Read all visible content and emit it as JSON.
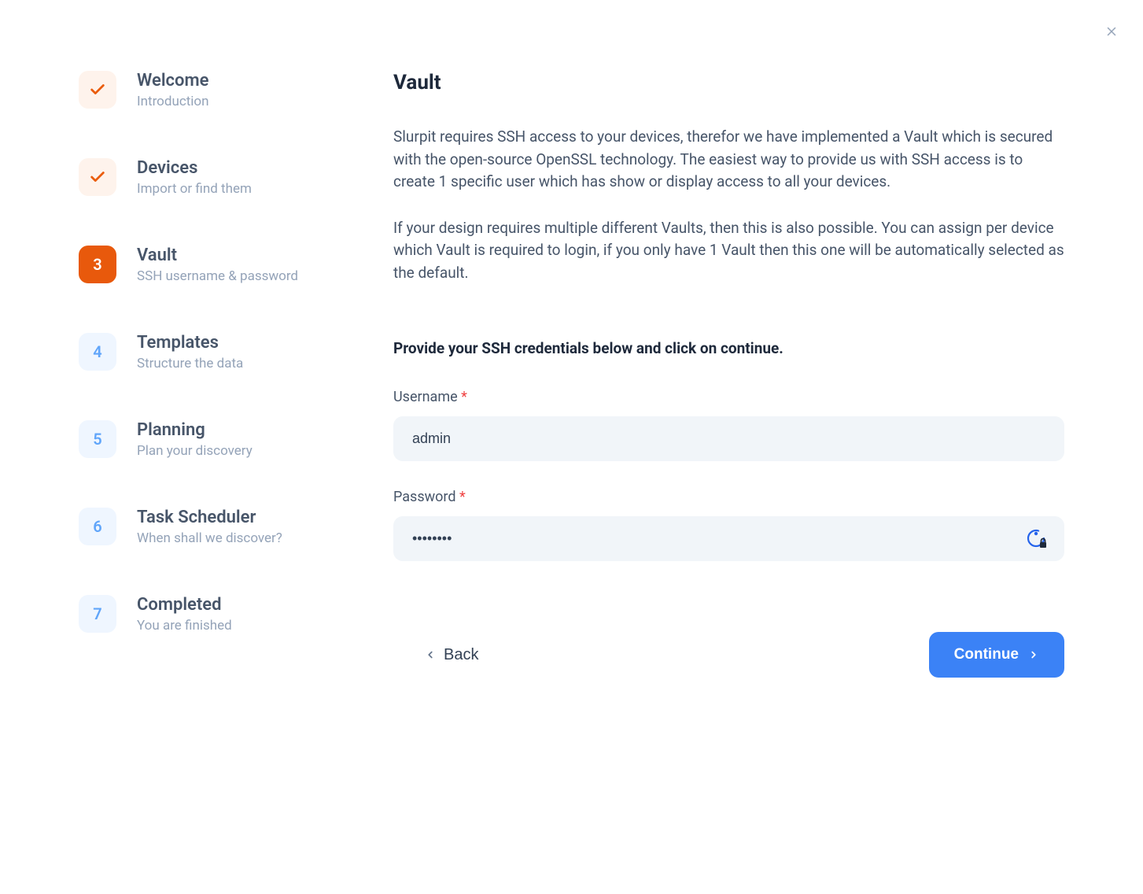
{
  "steps": [
    {
      "title": "Welcome",
      "subtitle": "Introduction",
      "status": "completed"
    },
    {
      "title": "Devices",
      "subtitle": "Import or find them",
      "status": "completed"
    },
    {
      "title": "Vault",
      "subtitle": "SSH username & password",
      "status": "active",
      "number": "3"
    },
    {
      "title": "Templates",
      "subtitle": "Structure the data",
      "status": "pending",
      "number": "4"
    },
    {
      "title": "Planning",
      "subtitle": "Plan your discovery",
      "status": "pending",
      "number": "5"
    },
    {
      "title": "Task Scheduler",
      "subtitle": "When shall we discover?",
      "status": "pending",
      "number": "6"
    },
    {
      "title": "Completed",
      "subtitle": "You are finished",
      "status": "pending",
      "number": "7"
    }
  ],
  "content": {
    "title": "Vault",
    "paragraph1": "Slurpit requires SSH access to your devices, therefor we have implemented a Vault which is secured with the open-source OpenSSL technology. The easiest way to provide us with SSH access is to create 1 specific user which has show or display access to all your devices.",
    "paragraph2": "If your design requires multiple different Vaults, then this is also possible. You can assign per device which Vault is required to login, if you only have 1 Vault then this one will be automatically selected as the default.",
    "instruction": "Provide your SSH credentials below and click on continue."
  },
  "form": {
    "username_label": "Username",
    "username_value": "admin",
    "password_label": "Password",
    "password_value": "••••••••"
  },
  "buttons": {
    "back": "Back",
    "continue": "Continue"
  },
  "required": "*"
}
